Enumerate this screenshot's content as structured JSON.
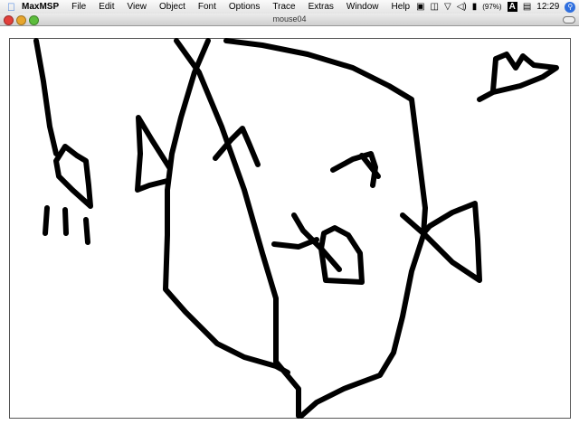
{
  "menubar": {
    "app": "MaxMSP",
    "items": [
      "File",
      "Edit",
      "View",
      "Object",
      "Font",
      "Options",
      "Trace",
      "Extras",
      "Window",
      "Help"
    ],
    "battery": "(97%)",
    "input_menu": "A",
    "clock": "12:29"
  },
  "window": {
    "title": "mouse04"
  },
  "colors": {
    "stroke": "#000000",
    "canvas": "#ffffff"
  }
}
